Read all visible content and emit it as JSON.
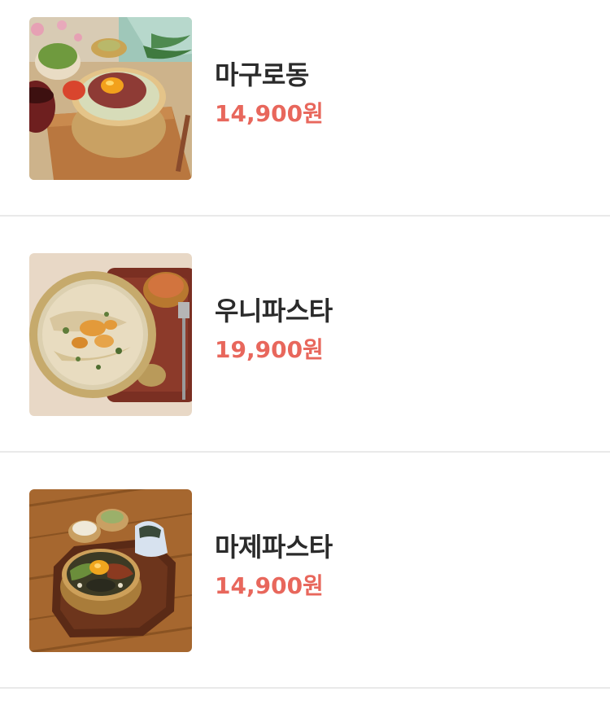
{
  "menu": {
    "items": [
      {
        "name": "마구로동",
        "price": "14,900원",
        "image_alt": "마구로동"
      },
      {
        "name": "우니파스타",
        "price": "19,900원",
        "image_alt": "우니파스타"
      },
      {
        "name": "마제파스타",
        "price": "14,900원",
        "image_alt": "마제파스타"
      }
    ]
  },
  "colors": {
    "price": "#e8675c",
    "name": "#2b2b2b",
    "divider": "#e9e9e9",
    "background": "#ffffff"
  }
}
